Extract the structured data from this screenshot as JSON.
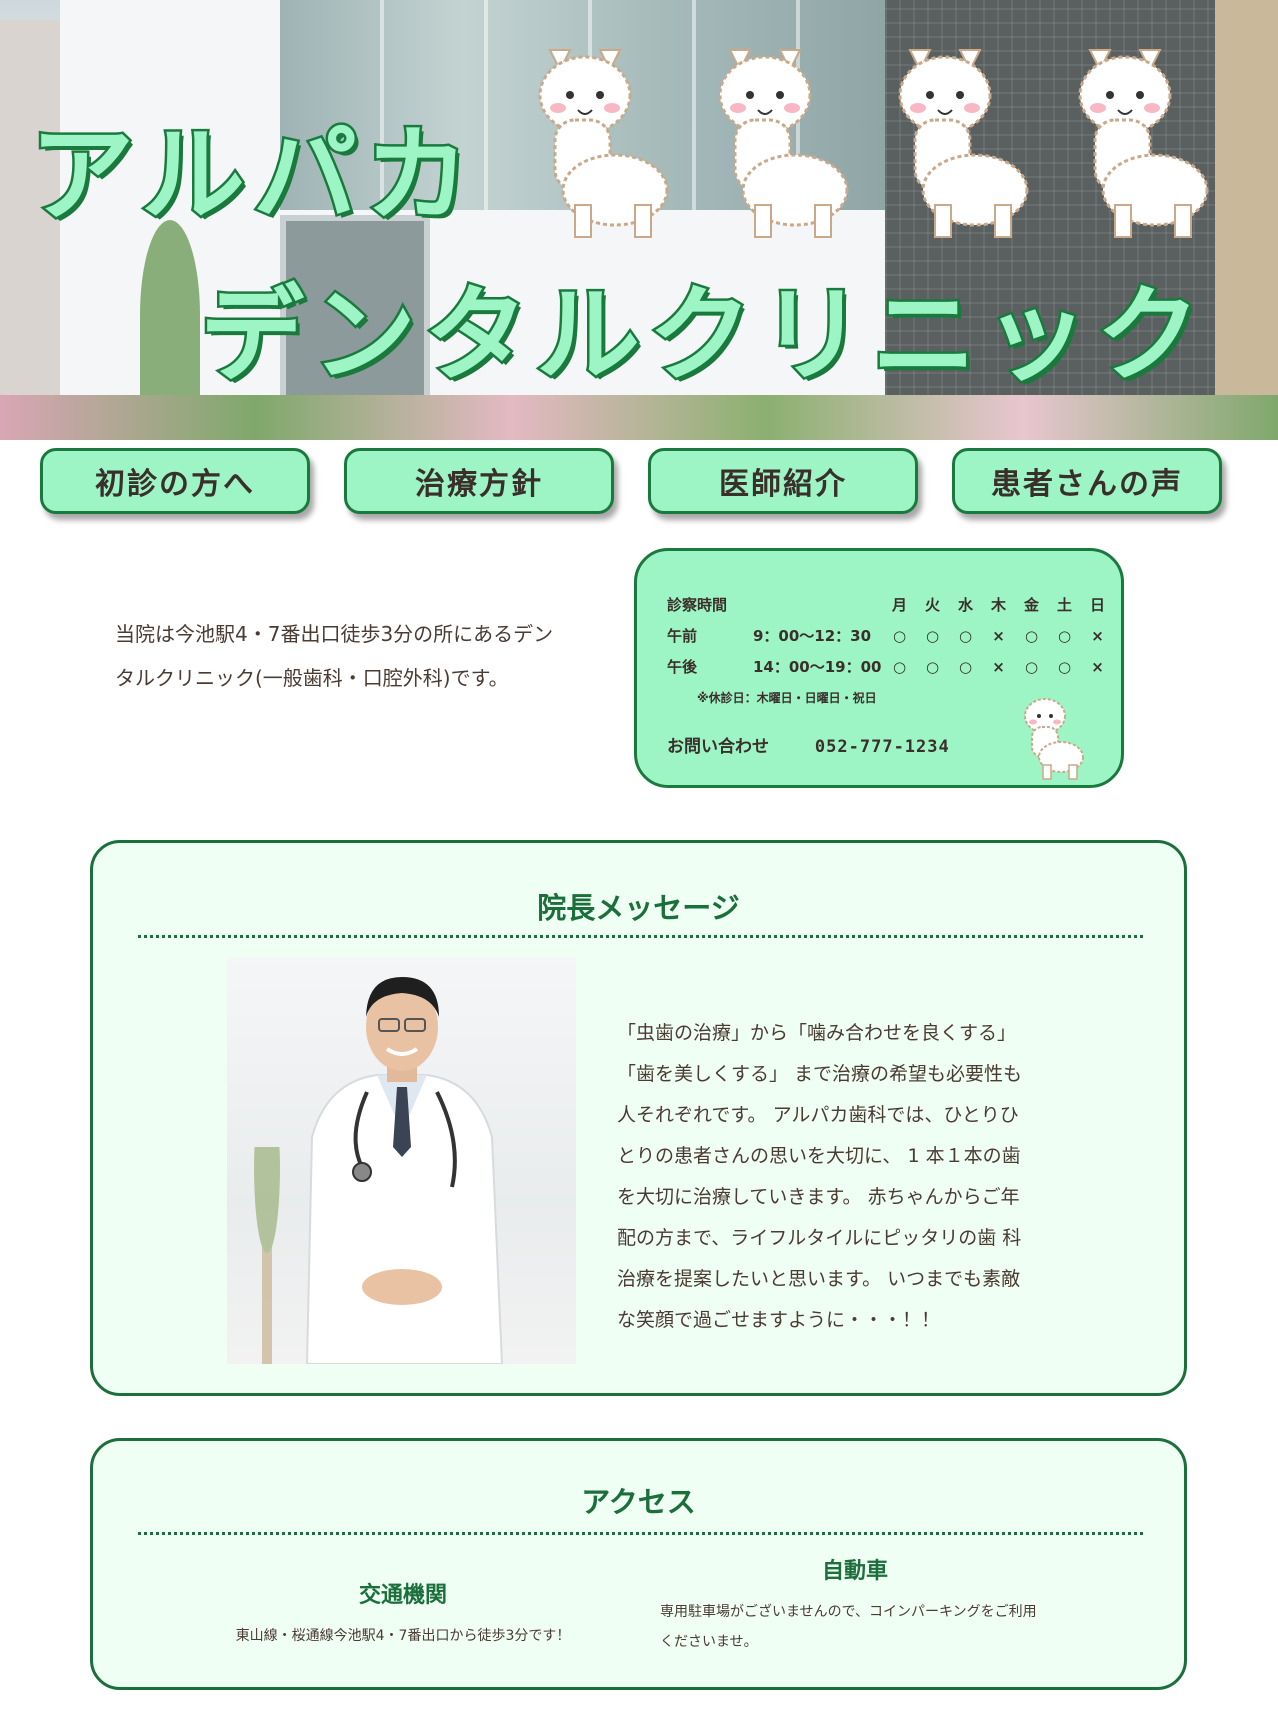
{
  "hero": {
    "title_line1": "アルパカ",
    "title_line2": "デンタルクリニック"
  },
  "nav": {
    "items": [
      {
        "label": "初診の方へ"
      },
      {
        "label": "治療方針"
      },
      {
        "label": "医師紹介"
      },
      {
        "label": "患者さんの声"
      }
    ]
  },
  "intro": {
    "text": "当院は今池駅4・7番出口徒歩3分の所にあるデンタルクリニック(一般歯科・口腔外科)です。"
  },
  "hours": {
    "header_label": "診察時間",
    "days": [
      "月",
      "火",
      "水",
      "木",
      "金",
      "土",
      "日"
    ],
    "rows": [
      {
        "label": "午前",
        "time": "9：00～12：30",
        "marks": [
          "○",
          "○",
          "○",
          "×",
          "○",
          "○",
          "×"
        ]
      },
      {
        "label": "午後",
        "time": "14：00～19：00",
        "marks": [
          "○",
          "○",
          "○",
          "×",
          "○",
          "○",
          "×"
        ]
      }
    ],
    "note": "※休診日：木曜日・日曜日・祝日",
    "contact_label": "お問い合わせ",
    "phone": "052-777-1234"
  },
  "message": {
    "title": "院長メッセージ",
    "text": "「虫歯の治療」から「噛み合わせを良くする」「歯を美しくする」 まで治療の希望も必要性も人それぞれです。 アルパカ歯科では、ひとりひとりの患者さんの思いを大切に、 1 本１本の歯を大切に治療していきます。 赤ちゃんからご年配の方まで、ライフルタイルにピッタリの歯 科治療を提案したいと思います。 いつまでも素敵な笑顔で過ごせますように・・・！！"
  },
  "access": {
    "title": "アクセス",
    "transit": {
      "heading": "交通機関",
      "text": "東山線・桜通線今池駅4・7番出口から徒歩3分です！"
    },
    "car": {
      "heading": "自動車",
      "text": "専用駐車場がございませんので、コインパーキングをご利用くださいませ。"
    }
  },
  "colors": {
    "mint": "#9df5c6",
    "green_dark": "#1a7a3e",
    "section_bg": "#f0fff4",
    "text": "#4a3b33"
  }
}
